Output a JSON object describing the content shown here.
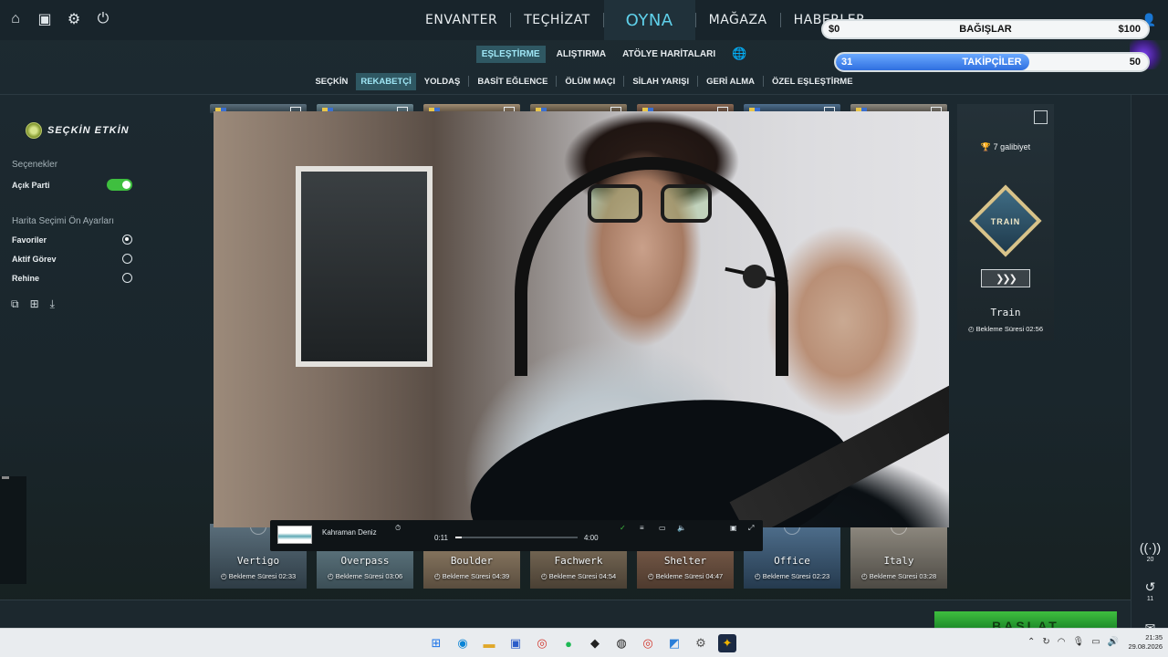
{
  "main_nav": [
    "ENVANTER",
    "TEÇHİZAT",
    "OYNA",
    "MAĞAZA",
    "HABERLER"
  ],
  "sub_nav": [
    "EŞLEŞTİRME",
    "ALIŞTIRMA",
    "ATÖLYE HARİTALARI"
  ],
  "mode_nav": [
    "SEÇKİN",
    "REKABETÇİ",
    "YOLDAŞ",
    "BASİT EĞLENCE",
    "ÖLÜM MAÇI",
    "SİLAH YARIŞI",
    "GERİ ALMA",
    "ÖZEL EŞLEŞTİRME"
  ],
  "overlay": {
    "donation": {
      "left": "$0",
      "title": "BAĞIŞLAR",
      "right": "$100"
    },
    "followers": {
      "left": "31",
      "title": "TAKİPÇİLER",
      "right": "50",
      "progress": 0.62
    }
  },
  "left_panel": {
    "premier_label": "SEÇKİN ETKİN",
    "options_label": "Seçenekler",
    "open_party": "Açık Parti",
    "preset_label": "Harita Seçimi Ön Ayarları",
    "presets": [
      {
        "label": "Favoriler",
        "selected": true
      },
      {
        "label": "Aktif Görev",
        "selected": false
      },
      {
        "label": "Rehine",
        "selected": false
      }
    ]
  },
  "maps": [
    {
      "name": "Vertigo",
      "cooldown": "Bekleme Süresi 02:33",
      "colors": [
        "#5b6f7c",
        "#2e3c45"
      ]
    },
    {
      "name": "Overpass",
      "cooldown": "Bekleme Süresi 03:06",
      "colors": [
        "#6d8791",
        "#3b4e56"
      ]
    },
    {
      "name": "Boulder",
      "cooldown": "Bekleme Süresi 04:39",
      "colors": [
        "#a08d73",
        "#5a4d3e"
      ]
    },
    {
      "name": "Fachwerk",
      "cooldown": "Bekleme Süresi 04:54",
      "colors": [
        "#8d7d66",
        "#4a4034"
      ]
    },
    {
      "name": "Shelter",
      "cooldown": "Bekleme Süresi 04:47",
      "colors": [
        "#8a6a55",
        "#4e3a2e"
      ]
    },
    {
      "name": "Office",
      "cooldown": "Bekleme Süresi 02:23",
      "colors": [
        "#4f6f8d",
        "#253a4e"
      ]
    },
    {
      "name": "Italy",
      "cooldown": "Bekleme Süresi 03:28",
      "colors": [
        "#8f8a80",
        "#4d4a44"
      ]
    }
  ],
  "featured_map": {
    "wins": "7 galibiyet",
    "emblem": "TRAIN",
    "name": "Train",
    "cooldown": "Bekleme Süresi 02:56"
  },
  "player": {
    "track": "Kahraman Deniz",
    "elapsed": "0:11",
    "total": "4:00",
    "progress": 0.05
  },
  "rail": [
    {
      "count": "20"
    },
    {
      "count": "11"
    }
  ],
  "start_button": "BAŞLAT",
  "clock": {
    "time": "21:35",
    "date": "29.08.2026"
  },
  "colors": {
    "accent": "#5fd0ea",
    "toggle_on": "#3fbf3f",
    "start_green": "#2fa83a"
  }
}
